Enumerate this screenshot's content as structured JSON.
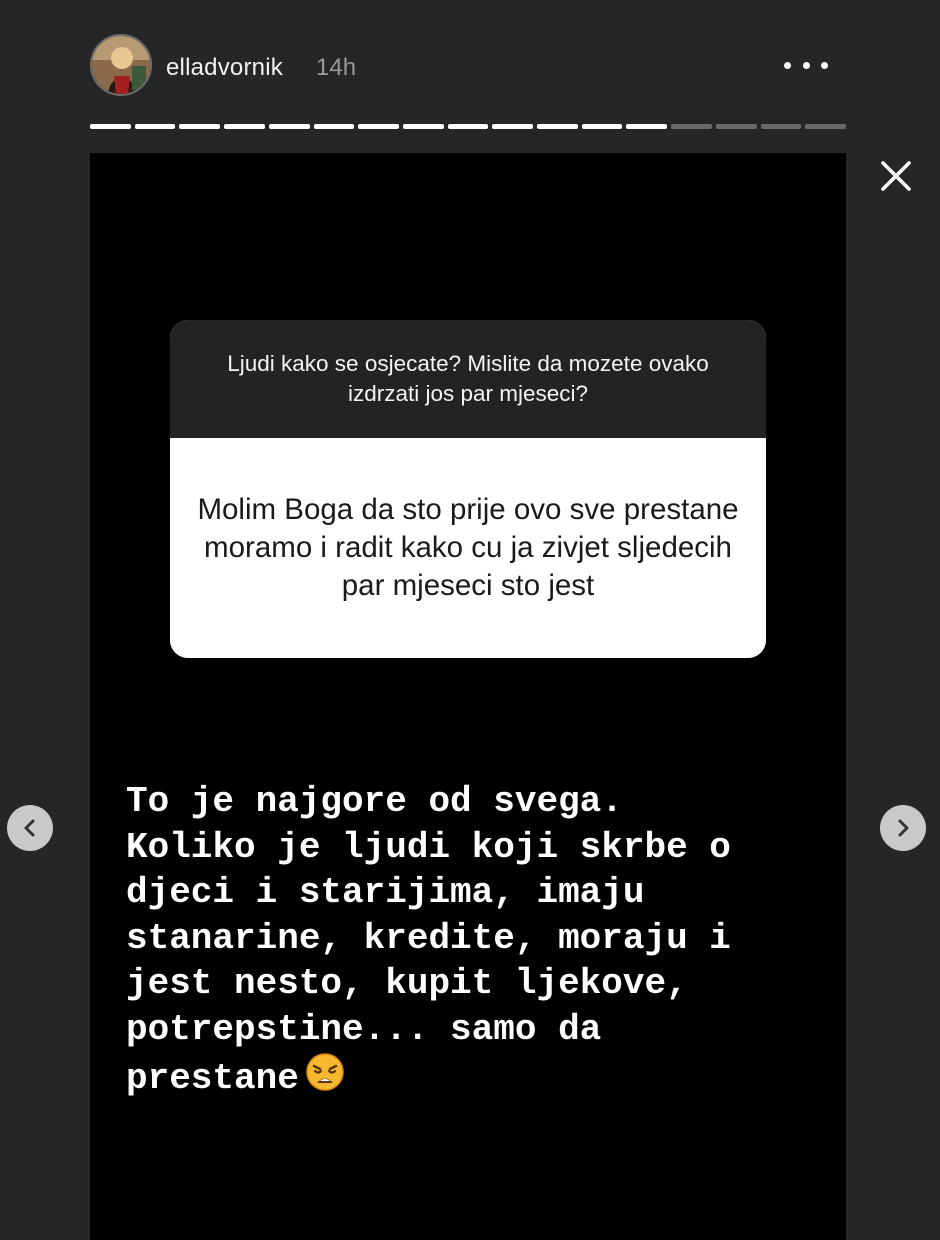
{
  "header": {
    "username": "elladvornik",
    "timestamp": "14h",
    "avatar_icon": "profile-photo",
    "more_icon": "more-horizontal-icon"
  },
  "progress": {
    "total_segments": 17,
    "completed_segments": 13
  },
  "controls": {
    "close_icon": "close-icon",
    "prev_icon": "chevron-left-icon",
    "next_icon": "chevron-right-icon"
  },
  "question_box": {
    "question": "Ljudi kako se osjecate? Mislite da mozete ovako izdrzati jos par mjeseci?",
    "answer": "Molim Boga da sto prije ovo sve prestane moramo i radit kako cu ja zivjet sljedecih par mjeseci sto jest"
  },
  "caption": {
    "text": "To je najgore od svega.\nKoliko je ljudi koji skrbe o\ndjeci i starijima, imaju\nstanarine, kredite, moraju i\njest nesto, kupit ljekove,\npotrepstine... samo da\nprestane",
    "emoji": "weary-face-emoji"
  },
  "colors": {
    "background": "#262626",
    "story_background": "#000000",
    "progress_done": "#ffffff",
    "progress_remaining": "#6a6a6a",
    "question_header": "#232323"
  }
}
